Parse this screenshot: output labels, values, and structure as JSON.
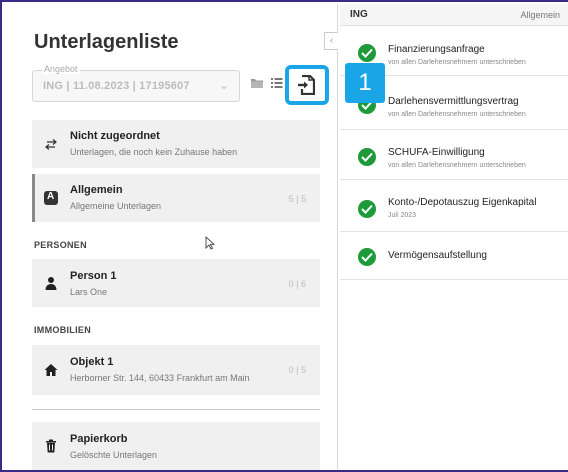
{
  "left": {
    "title": "Unterlagenliste",
    "angebot": {
      "label": "Angebot",
      "value": "ING | 11.08.2023 | 17195607"
    },
    "callout_number": "1",
    "cards": [
      {
        "title": "Nicht zugeordnet",
        "subtitle": "Unterlagen, die noch kein Zuhause haben",
        "count": ""
      },
      {
        "title": "Allgemein",
        "subtitle": "Allgemeine Unterlagen",
        "count": "5 | 5",
        "icon_letter": "A"
      }
    ],
    "sections": {
      "persons": "PERSONEN",
      "properties": "IMMOBILIEN"
    },
    "person": {
      "title": "Person 1",
      "subtitle": "Lars One",
      "count": "0 | 6"
    },
    "property": {
      "title": "Objekt 1",
      "subtitle": "Herborner Str. 144, 60433 Frankfurt am Main",
      "count": "0 | 5"
    },
    "trash": {
      "title": "Papierkorb",
      "subtitle": "Gelöschte Unterlagen"
    }
  },
  "right": {
    "header_left": "ING",
    "header_right": "Allgemein",
    "items": [
      {
        "title": "Finanzierungsanfrage",
        "subtitle": "von allen Darlehensnehmern unterschrieben"
      },
      {
        "title": "Darlehensvermittlungsvertrag",
        "subtitle": "von allen Darlehensnehmern unterschrieben"
      },
      {
        "title": "SCHUFA-Einwilligung",
        "subtitle": "von allen Darlehensnehmern unterschrieben"
      },
      {
        "title": "Konto-/Depotauszug Eigenkapital",
        "subtitle": "Juli 2023"
      },
      {
        "title": "Vermögensaufstellung",
        "subtitle": ""
      }
    ]
  },
  "colors": {
    "accent": "#1aa6e6",
    "check": "#1e9a3a",
    "frame": "#3b2a8a"
  }
}
